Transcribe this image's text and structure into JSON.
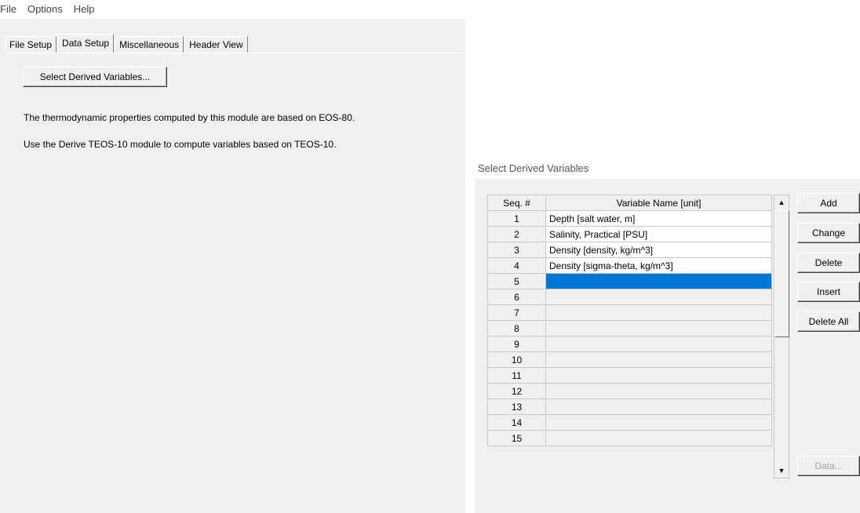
{
  "menu": [
    "File",
    "Options",
    "Help"
  ],
  "tabs": [
    "File Setup",
    "Data Setup",
    "Miscellaneous",
    "Header View"
  ],
  "active_tab": "Data Setup",
  "data_setup": {
    "select_button": "Select Derived Variables...",
    "info_line1": "The thermodynamic properties computed by this module are based on EOS-80.",
    "info_line2": "Use the Derive TEOS-10 module to compute variables based on TEOS-10."
  },
  "dialog": {
    "title": "Select Derived Variables",
    "columns": {
      "seq": "Seq. #",
      "name": "Variable Name [unit]"
    },
    "rows": [
      {
        "seq": "1",
        "name": "Depth [salt water, m]"
      },
      {
        "seq": "2",
        "name": "Salinity, Practical [PSU]"
      },
      {
        "seq": "3",
        "name": "Density [density, kg/m^3]"
      },
      {
        "seq": "4",
        "name": "Density [sigma-theta, kg/m^3]"
      },
      {
        "seq": "5",
        "name": ""
      },
      {
        "seq": "6",
        "name": ""
      },
      {
        "seq": "7",
        "name": ""
      },
      {
        "seq": "8",
        "name": ""
      },
      {
        "seq": "9",
        "name": ""
      },
      {
        "seq": "10",
        "name": ""
      },
      {
        "seq": "11",
        "name": ""
      },
      {
        "seq": "12",
        "name": ""
      },
      {
        "seq": "13",
        "name": ""
      },
      {
        "seq": "14",
        "name": ""
      },
      {
        "seq": "15",
        "name": ""
      }
    ],
    "selected_row": 5,
    "buttons": {
      "add": "Add",
      "change": "Change",
      "delete": "Delete",
      "insert": "Insert",
      "delete_all": "Delete All",
      "data": "Data..."
    },
    "scroll_up_icon": "▲",
    "scroll_down_icon": "▼"
  },
  "colors": {
    "selection": "#0078d7",
    "panel": "#f0f0f0"
  }
}
